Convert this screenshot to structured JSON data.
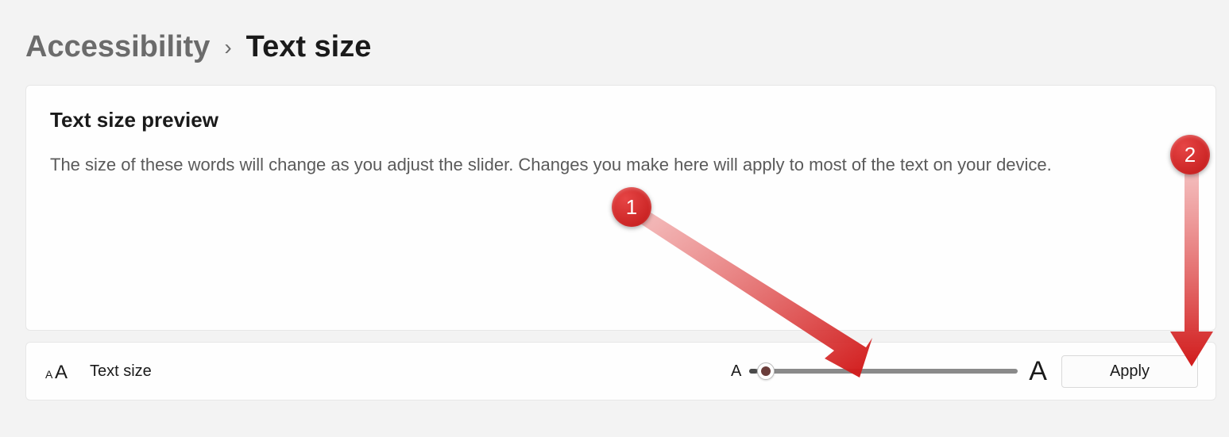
{
  "breadcrumb": {
    "parent": "Accessibility",
    "separator": "›",
    "current": "Text size"
  },
  "preview": {
    "title": "Text size preview",
    "description": "The size of these words will change as you adjust the slider. Changes you make here will apply to most of the text on your device."
  },
  "slider_row": {
    "label": "Text size",
    "min_marker": "A",
    "max_marker": "A",
    "apply_label": "Apply"
  },
  "annotations": {
    "callout1": "1",
    "callout2": "2"
  }
}
